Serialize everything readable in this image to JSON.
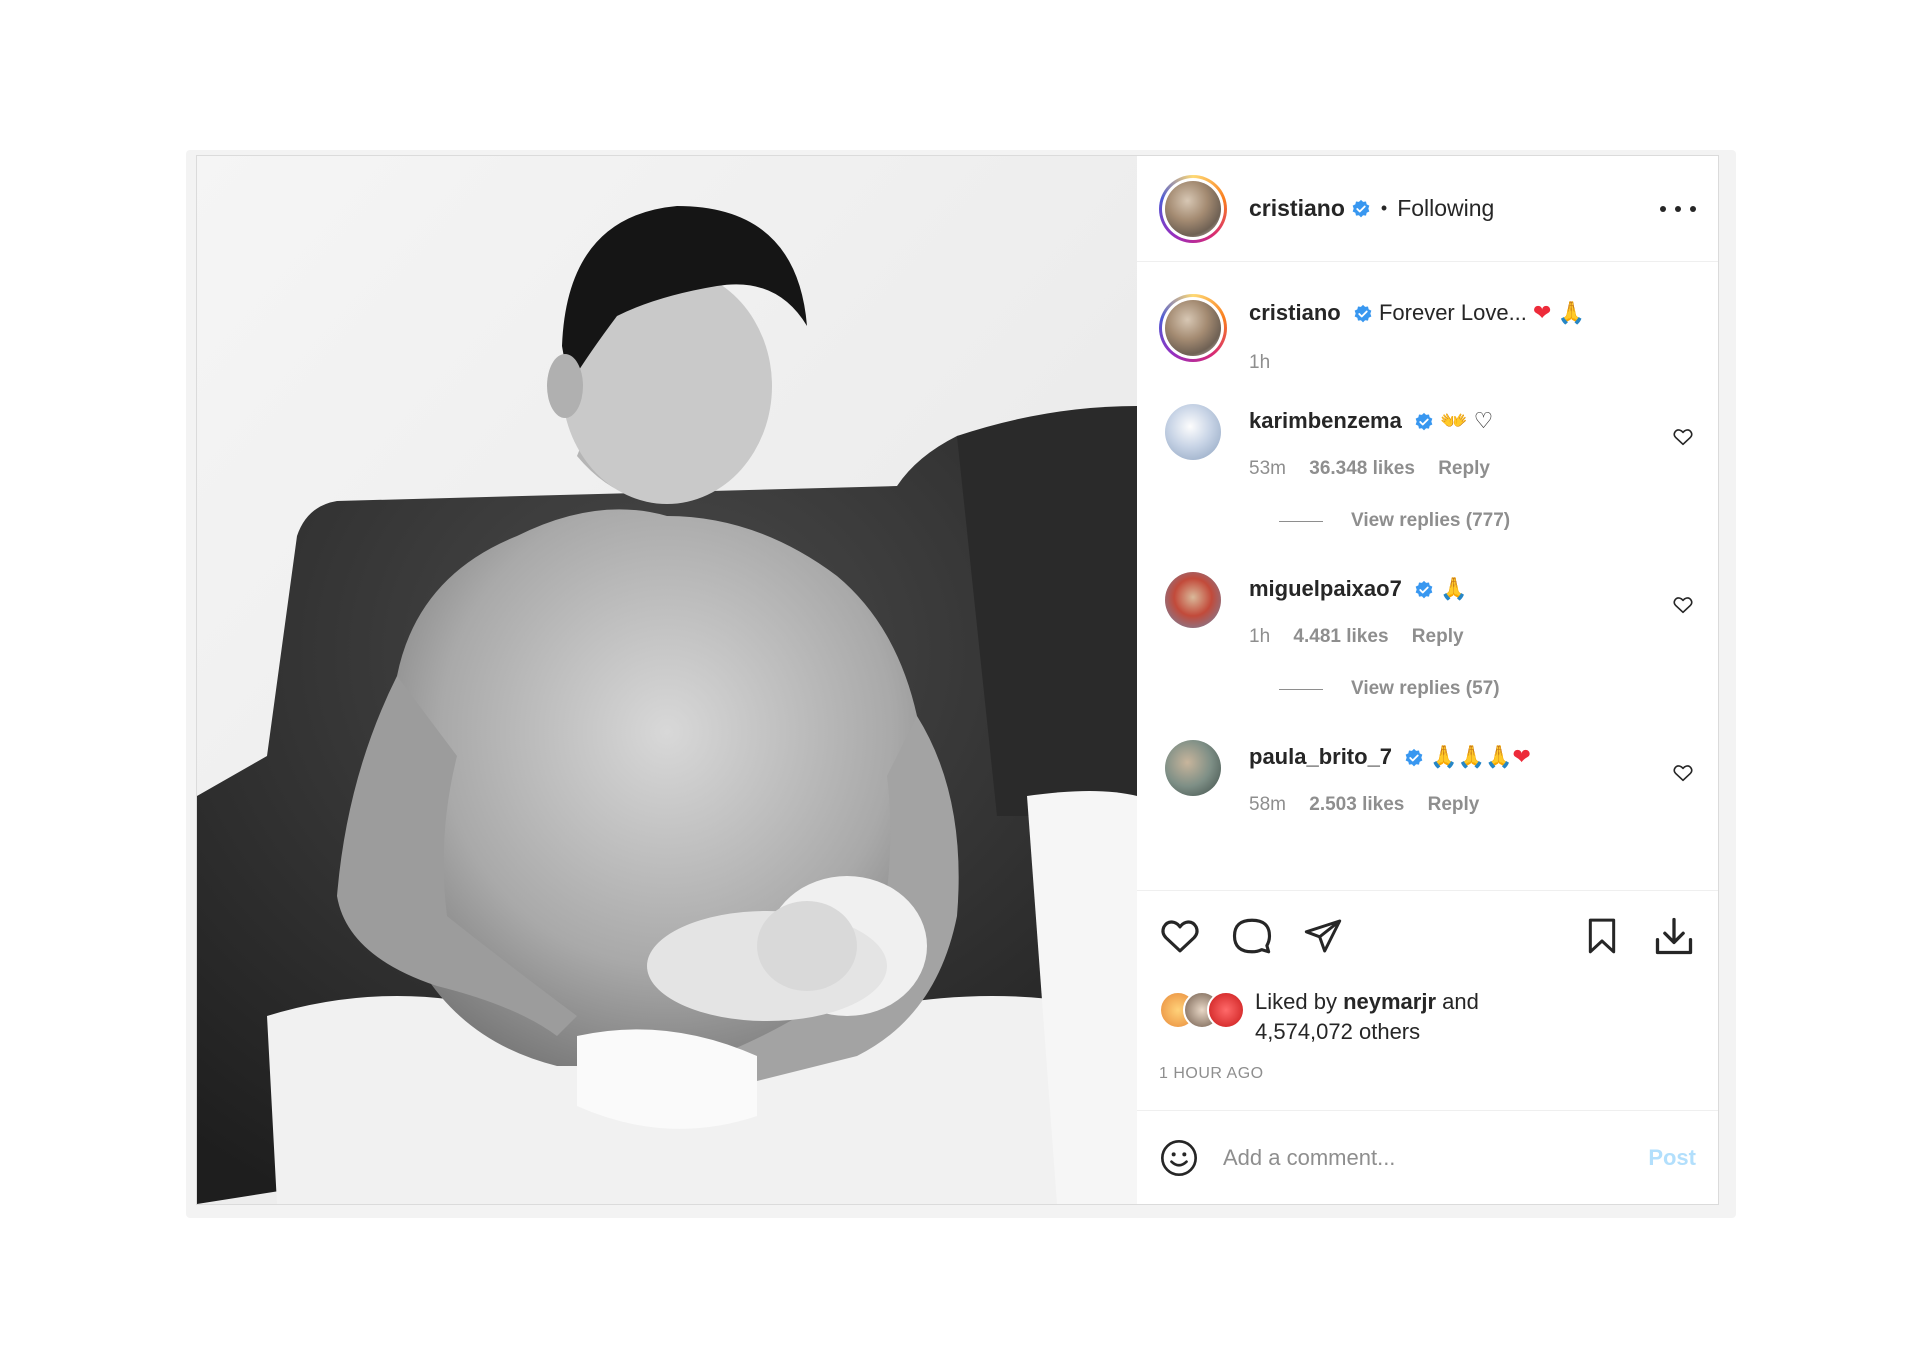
{
  "header": {
    "username": "cristiano",
    "separator": "•",
    "follow_status": "Following"
  },
  "caption": {
    "username": "cristiano",
    "text": "Forever Love...",
    "emoji": [
      "heart-red",
      "praying-hands"
    ],
    "time": "1h"
  },
  "comments": [
    {
      "username": "karimbenzema",
      "emoji": [
        "open-hands-emoji",
        "white-heart-emoji"
      ],
      "time": "53m",
      "likes": "36.348 likes",
      "reply_label": "Reply",
      "view_replies": "View replies (777)"
    },
    {
      "username": "miguelpaixao7",
      "emoji": [
        "praying-hands"
      ],
      "time": "1h",
      "likes": "4.481 likes",
      "reply_label": "Reply",
      "view_replies": "View replies (57)"
    },
    {
      "username": "paula_brito_7",
      "emoji": [
        "praying-hands",
        "praying-hands",
        "praying-hands",
        "heart-red"
      ],
      "time": "58m",
      "likes": "2.503 likes",
      "reply_label": "Reply"
    }
  ],
  "likes_summary": {
    "prefix": "Liked by",
    "user": "neymarjr",
    "conj": "and",
    "others": "4,574,072 others"
  },
  "posted_ago": "1 HOUR AGO",
  "add_comment": {
    "placeholder": "Add a comment...",
    "post_label": "Post"
  },
  "colors": {
    "verified": "#3897f0",
    "link_disabled": "#b2dffc",
    "meta": "#8e8e8e",
    "heart": "#ed2b3a"
  }
}
